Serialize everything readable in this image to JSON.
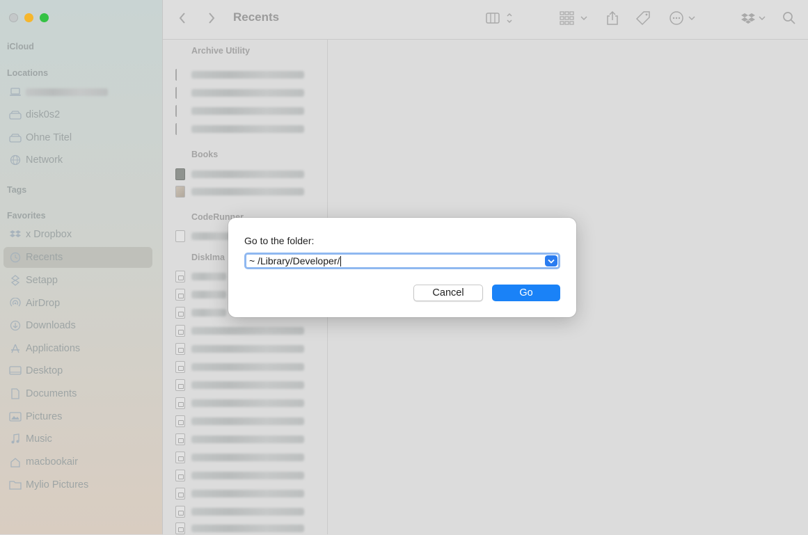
{
  "window": {
    "title": "Recents"
  },
  "sidebar": {
    "sections": [
      {
        "heading": "iCloud"
      },
      {
        "heading": "Locations"
      },
      {
        "heading": "Tags"
      },
      {
        "heading": "Favorites"
      }
    ],
    "locations": [
      {
        "label": "",
        "icon": "laptop-icon"
      },
      {
        "label": "disk0s2",
        "icon": "drive-icon"
      },
      {
        "label": "Ohne Titel",
        "icon": "drive-icon"
      },
      {
        "label": "Network",
        "icon": "network-icon"
      }
    ],
    "favorites": [
      {
        "label": "x Dropbox",
        "icon": "dropbox-icon"
      },
      {
        "label": "Recents",
        "icon": "clock-icon",
        "selected": true
      },
      {
        "label": "Setapp",
        "icon": "setapp-icon"
      },
      {
        "label": "AirDrop",
        "icon": "airdrop-icon"
      },
      {
        "label": "Downloads",
        "icon": "download-icon"
      },
      {
        "label": "Applications",
        "icon": "applications-icon"
      },
      {
        "label": "Desktop",
        "icon": "desktop-icon"
      },
      {
        "label": "Documents",
        "icon": "document-icon"
      },
      {
        "label": "Pictures",
        "icon": "pictures-icon"
      },
      {
        "label": "Music",
        "icon": "music-icon"
      },
      {
        "label": "macbookair",
        "icon": "home-icon"
      },
      {
        "label": "Mylio Pictures",
        "icon": "folder-icon"
      }
    ]
  },
  "list": {
    "groups": [
      "Archive Utility",
      "Books",
      "CodeRunner",
      "DiskIma"
    ]
  },
  "dialog": {
    "label": "Go to the folder:",
    "input_value": "~ /Library/Developer/",
    "cancel_label": "Cancel",
    "go_label": "Go"
  },
  "colors": {
    "accent": "#1a82f7",
    "focus_ring": "#8fb8f0"
  }
}
